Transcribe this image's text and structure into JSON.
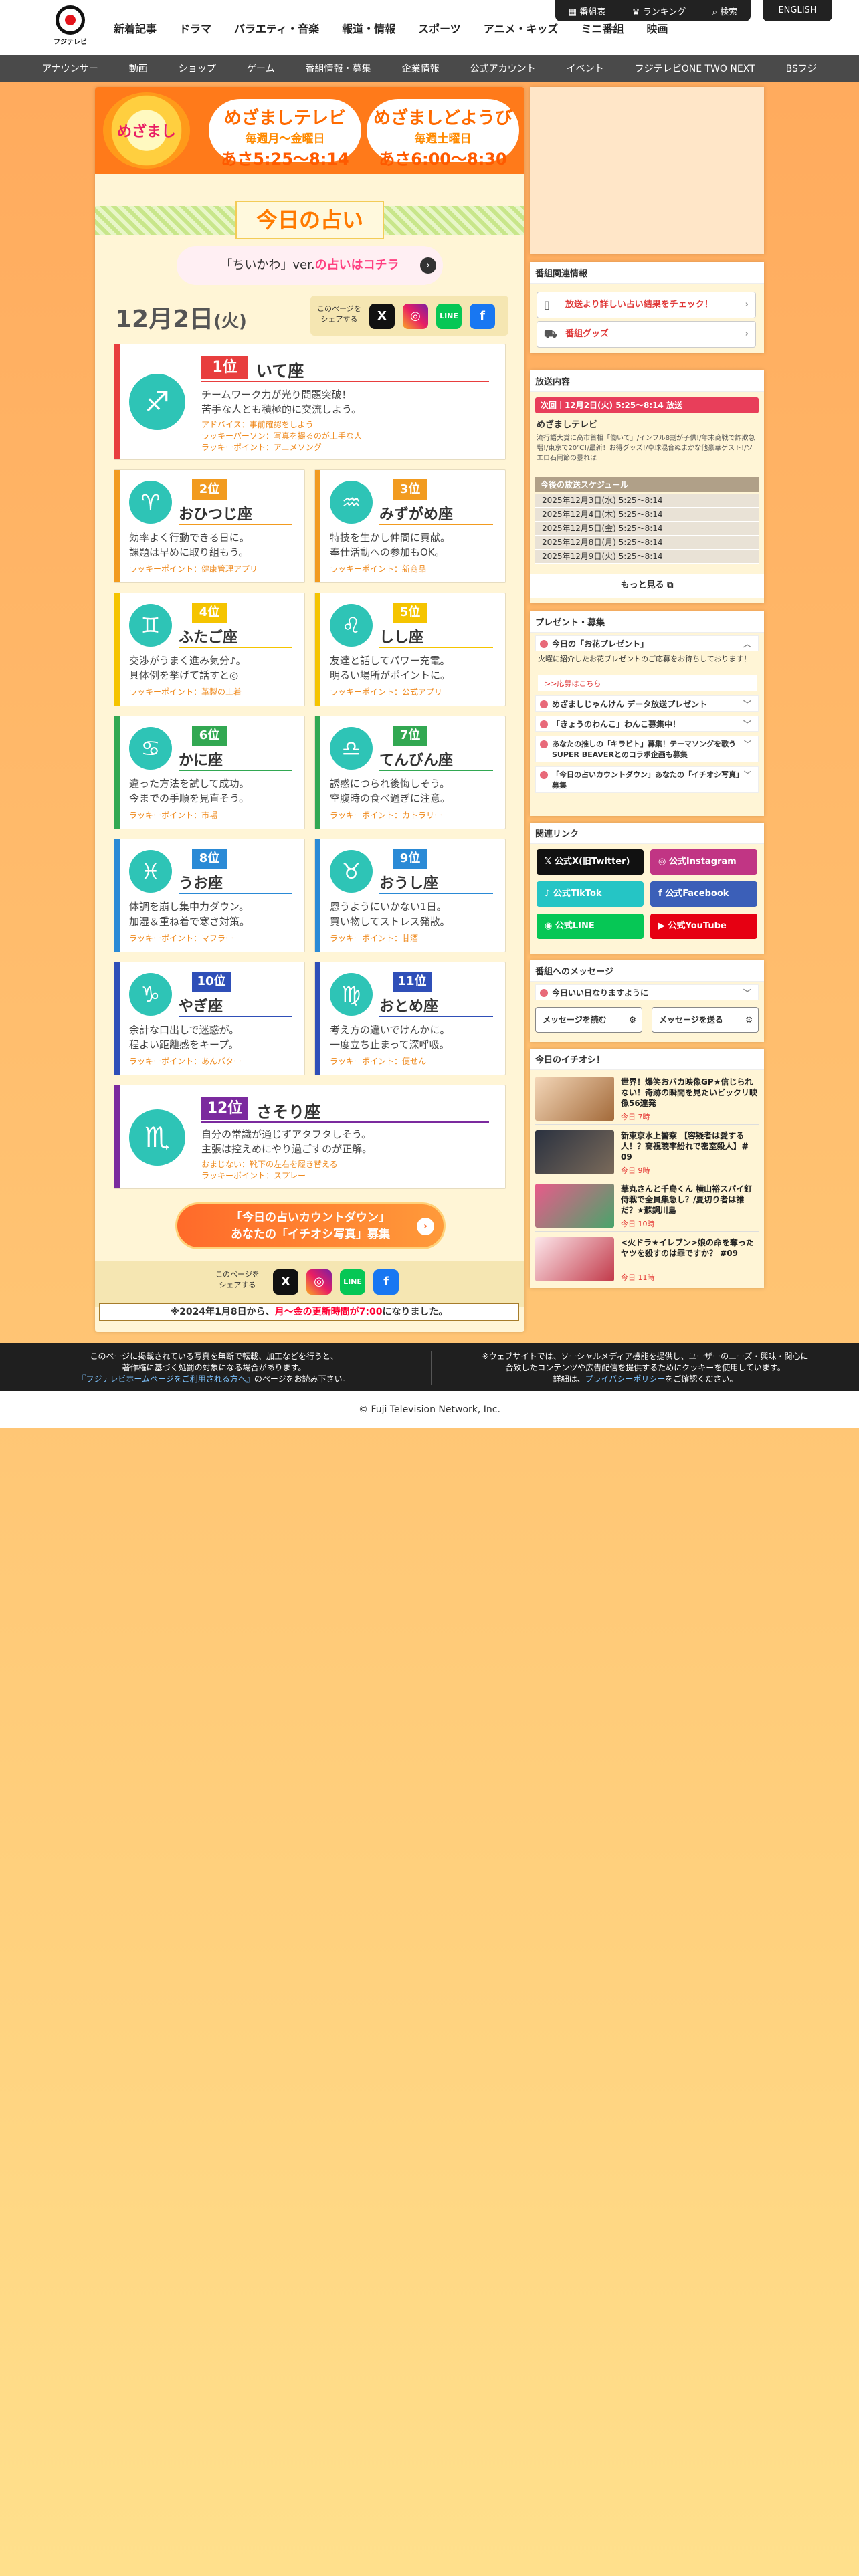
{
  "logo": {
    "text": "フジテレビ"
  },
  "nav": [
    "新着記事",
    "ドラマ",
    "バラエティ・音楽",
    "報道・情報",
    "スポーツ",
    "アニメ・キッズ",
    "ミニ番組",
    "映画"
  ],
  "util": {
    "schedule": "番組表",
    "ranking": "ランキング",
    "search": "検索",
    "english": "ENGLISH"
  },
  "subnav": [
    "アナウンサー",
    "動画",
    "ショップ",
    "ゲーム",
    "番組情報・募集",
    "企業情報",
    "公式アカウント",
    "イベント",
    "フジテレビONE TWO NEXT",
    "BSフジ"
  ],
  "banner": {
    "logo_text": "めざまし",
    "weekday": {
      "title": "めざましテレビ",
      "days": "毎週月～金曜日",
      "time": "あさ5:25〜8:14"
    },
    "saturday": {
      "title": "めざましどようび",
      "days": "毎週土曜日",
      "time": "あさ6:00〜8:30"
    }
  },
  "page_title": "今日の占い",
  "chiikawa": {
    "pre": "「ちいかわ」ver.",
    "link": "の占いはコチラ"
  },
  "date": {
    "month_day": "12月2日",
    "weekday": "(火)"
  },
  "share_label": "このページを\nシェアする",
  "share_icons": [
    "X",
    "◎",
    "LINE",
    "f"
  ],
  "colors": {
    "accent": "#ff7a00",
    "red": "#e03a3a",
    "teal": "#2ec4b6"
  },
  "fortunes": [
    {
      "rank": "1位",
      "sign": "いて座",
      "symbol": "♐",
      "desc1": "チームワーク力が光り問題突破！",
      "desc2": "苦手な人とも積極的に交流しよう。",
      "advice": "アドバイス：事前確認をしよう",
      "lucky_person": "ラッキーパーソン：写真を撮るのが上手な人",
      "lucky_point": "ラッキーポイント：アニメソング",
      "color": "#e83e3e"
    },
    {
      "rank": "2位",
      "sign": "おひつじ座",
      "symbol": "♈",
      "desc1": "効率よく行動できる日に。",
      "desc2": "課題は早めに取り組もう。",
      "lucky_point": "ラッキーポイント：健康管理アプリ",
      "color": "#f29b1f"
    },
    {
      "rank": "3位",
      "sign": "みずがめ座",
      "symbol": "♒",
      "desc1": "特技を生かし仲間に貢献。",
      "desc2": "奉仕活動への参加もOK。",
      "lucky_point": "ラッキーポイント：新商品",
      "color": "#f29b1f"
    },
    {
      "rank": "4位",
      "sign": "ふたご座",
      "symbol": "♊",
      "desc1": "交渉がうまく進み気分♪。",
      "desc2": "具体例を挙げて話すと◎",
      "lucky_point": "ラッキーポイント：革製の上着",
      "color": "#f5c400"
    },
    {
      "rank": "5位",
      "sign": "しし座",
      "symbol": "♌",
      "desc1": "友達と話してパワー充電。",
      "desc2": "明るい場所がポイントに。",
      "lucky_point": "ラッキーポイント：公式アプリ",
      "color": "#f5c400"
    },
    {
      "rank": "6位",
      "sign": "かに座",
      "symbol": "♋",
      "desc1": "違った方法を試して成功。",
      "desc2": "今までの手順を見直そう。",
      "lucky_point": "ラッキーポイント：市場",
      "color": "#32a852"
    },
    {
      "rank": "7位",
      "sign": "てんびん座",
      "symbol": "♎",
      "desc1": "誘惑につられ後悔しそう。",
      "desc2": "空腹時の食べ過ぎに注意。",
      "lucky_point": "ラッキーポイント：カトラリー",
      "color": "#32a852"
    },
    {
      "rank": "8位",
      "sign": "うお座",
      "symbol": "♓",
      "desc1": "体調を崩し集中力ダウン。",
      "desc2": "加湿＆重ね着で寒さ対策。",
      "lucky_point": "ラッキーポイント：マフラー",
      "color": "#2a8ad6"
    },
    {
      "rank": "9位",
      "sign": "おうし座",
      "symbol": "♉",
      "desc1": "恩うようにいかない1日。",
      "desc2": "買い物してストレス発散。",
      "lucky_point": "ラッキーポイント：甘酒",
      "color": "#2a8ad6"
    },
    {
      "rank": "10位",
      "sign": "やぎ座",
      "symbol": "♑",
      "desc1": "余計な口出しで迷惑が。",
      "desc2": "程よい距離感をキープ。",
      "lucky_point": "ラッキーポイント：あんバター",
      "color": "#2f4fb8"
    },
    {
      "rank": "11位",
      "sign": "おとめ座",
      "symbol": "♍",
      "desc1": "考え方の違いでけんかに。",
      "desc2": "一度立ち止まって深呼吸。",
      "lucky_point": "ラッキーポイント：便せん",
      "color": "#2f4fb8"
    },
    {
      "rank": "12位",
      "sign": "さそり座",
      "symbol": "♏",
      "desc1": "自分の常識が通じずアタフタしそう。",
      "desc2": "主張は控えめにやり過ごすのが正解。",
      "advice": "おまじない：靴下の左右を履き替える",
      "lucky_point": "ラッキーポイント：スプレー",
      "color": "#7b2a9e"
    }
  ],
  "countdown": {
    "line1": "「今日の占いカウントダウン」",
    "line2": "あなたの「イチオシ写真」募集"
  },
  "notice": {
    "pre": "※2024年1月8日から、",
    "red": "月〜金の更新時間が7:00",
    "post": "になりました。"
  },
  "side": {
    "related_title": "番組関連情報",
    "related_links": [
      "放送より詳しい占い結果をチェック！",
      "番組グッズ"
    ],
    "broadcast_title": "放送内容",
    "next": "次回｜12月2日(火) 5:25〜8:14 放送",
    "program": "めざましテレビ",
    "program_desc": "流行語大賞に高市首相「働いて」/インフル8割が子供!/年末商戦で詐欺急増!/東京で20℃!/最新！お得グッズ!/卓球混合ぬまかな他豪華ゲスト!/ソエロ石岡節の暴れは",
    "schedule_title": "今後の放送スケジュール",
    "schedule": [
      "2025年12月3日(水) 5:25〜8:14",
      "2025年12月4日(木) 5:25〜8:14",
      "2025年12月5日(金) 5:25〜8:14",
      "2025年12月8日(月) 5:25〜8:14",
      "2025年12月9日(火) 5:25〜8:14"
    ],
    "more": "もっと見る",
    "present_title": "プレゼント・募集",
    "present_open": "今日の「お花プレゼント」",
    "present_open_body": "火曜に紹介したお花プレゼントのご応募をお待ちしております！",
    "present_open_link": ">>応募はこちら",
    "present_items": [
      "めざましじゃんけん データ放送プレゼント",
      "「きょうのわんこ」わんこ募集中！",
      "あなたの推しの「キラビト」募集！テーマソングを歌うSUPER BEAVERとのコラボ企画も募集",
      "「今日の占いカウントダウン」あなたの「イチオシ写真」募集"
    ],
    "sns_title": "関連リンク",
    "sns": [
      "公式X(旧Twitter)",
      "公式Instagram",
      "公式TikTok",
      "公式Facebook",
      "公式LINE",
      "公式YouTube"
    ],
    "msg_title": "番組へのメッセージ",
    "msg_head": "今日いい日なりますように",
    "msg_read": "メッセージを読む",
    "msg_send": "メッセージを送る",
    "ichioshi_title": "今日のイチオシ！",
    "news": [
      {
        "title": "世界！爆笑おバカ映像GP★信じられない！奇跡の瞬間を見たいビックリ映像56連発",
        "date": "今日 7時"
      },
      {
        "title": "新東京水上警察 【容疑者は愛する人！？高視聴率紛れで密室殺人】＃09",
        "date": "今日 9時"
      },
      {
        "title": "華丸さんと千鳥くん 横山裕スパイ釘侍戦で全員集急し？/夏切り者は誰だ？★蘇鋼川島",
        "date": "今日 10時"
      },
      {
        "title": "<火ドラ★イレブン>娘の命を奪ったヤツを殺すのは罪ですか？ #09",
        "date": "今日 11時"
      }
    ]
  },
  "footer": {
    "left1": "このページに掲載されている写真を無断で転載、加工などを行うと、",
    "left2": "著作権に基づく処罰の対象になる場合があります。",
    "left3_link": "『フジテレビホームページをご利用される方へ』",
    "left3_post": "のページをお読み下さい。",
    "right1": "※ウェブサイトでは、ソーシャルメディア機能を提供し、ユーザーのニーズ・興味・関心に",
    "right2": "合致したコンテンツや広告配信を提供するためにクッキーを使用しています。",
    "right3_pre": "詳細は、",
    "right3_link": "プライバシーポリシー",
    "right3_post": "をご確認ください。",
    "copyright": "© Fuji Television Network, Inc."
  }
}
